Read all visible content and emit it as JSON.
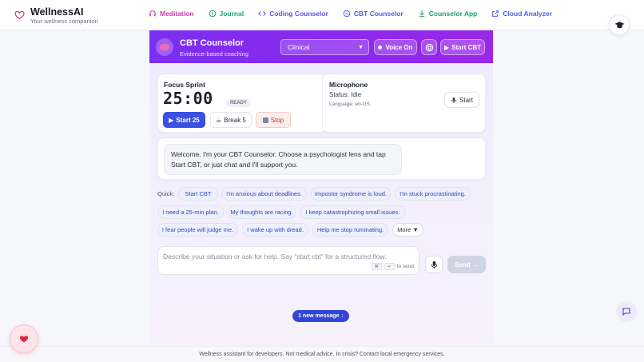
{
  "brand": {
    "name": "WellnessAI",
    "tagline": "Your wellness companion"
  },
  "nav": [
    {
      "label": "Meditation",
      "icon": "headphones-icon",
      "color": "#d23aa8"
    },
    {
      "label": "Journal",
      "icon": "journal-icon",
      "color": "#1ba46a"
    },
    {
      "label": "Coding Counselor",
      "icon": "code-icon",
      "color": "#5b54e8"
    },
    {
      "label": "CBT Counselor",
      "icon": "info-icon",
      "color": "#4b5ff0"
    },
    {
      "label": "Counselor App",
      "icon": "download-icon",
      "color": "#1ba46a"
    },
    {
      "label": "Cloud Analyzer",
      "icon": "external-link-icon",
      "color": "#4b5ff0"
    }
  ],
  "counselor": {
    "title": "CBT Counselor",
    "subtitle": "Evidence-based coaching",
    "lens_selected": "Clinical",
    "voice_label": "Voice On",
    "start_cbt_label": "Start CBT",
    "accent": "#8a28ee"
  },
  "focus": {
    "title": "Focus Sprint",
    "timer": "25:00",
    "status": "READY",
    "start_label": "Start 25",
    "break_label": "Break 5",
    "stop_label": "Stop"
  },
  "microphone": {
    "title": "Microphone",
    "status": "Status: Idle",
    "language": "Language: en-US",
    "start_label": "Start"
  },
  "chat": {
    "welcome": "Welcome. I'm your CBT Counselor. Choose a psychologist lens and tap Start CBT, or just chat and I'll support you."
  },
  "quick": {
    "label": "Quick:",
    "chips": [
      "Start CBT",
      "I'm anxious about deadlines.",
      "Impostor syndrome is loud.",
      "I'm stuck procrastinating.",
      "I need a 25-min plan.",
      "My thoughts are racing.",
      "I keep catastrophizing small issues.",
      "I fear people will judge me.",
      "I wake up with dread.",
      "Help me stop ruminating."
    ],
    "more_label": "More ▼"
  },
  "composer": {
    "placeholder": "Describe your situation or ask for help. Say \"start cbt\" for a structured flow.",
    "hint": "to send",
    "send_label": "Send →"
  },
  "new_message": "1 new message ↓",
  "footer": "Wellness assistant for developers. Not medical advice. In crisis? Contact local emergency services."
}
